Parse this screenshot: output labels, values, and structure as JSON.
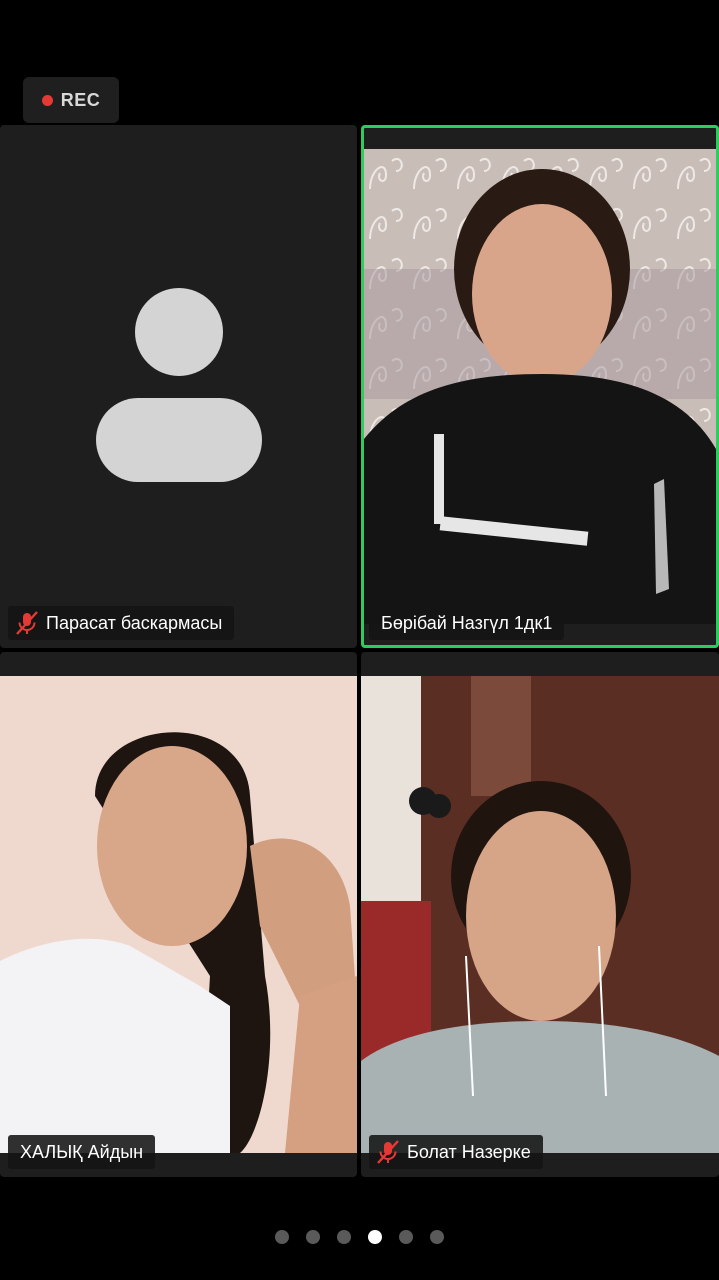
{
  "recording": {
    "label": "REC",
    "dot_color": "#e53935"
  },
  "participants": [
    {
      "name": "Парасат баскармасы",
      "muted": true,
      "video": false,
      "active_speaker": false
    },
    {
      "name": "Бөрібай Назгүл 1дк1",
      "muted": false,
      "video": true,
      "active_speaker": true
    },
    {
      "name": "ХАЛЫҚ Айдын",
      "muted": false,
      "video": true,
      "active_speaker": false
    },
    {
      "name": "Болат Назерке",
      "muted": true,
      "video": true,
      "active_speaker": false
    }
  ],
  "pagination": {
    "total_pages": 6,
    "current_page": 4
  },
  "colors": {
    "active_speaker_border": "#2ecc5a",
    "muted_icon": "#e53935",
    "background": "#000000"
  }
}
